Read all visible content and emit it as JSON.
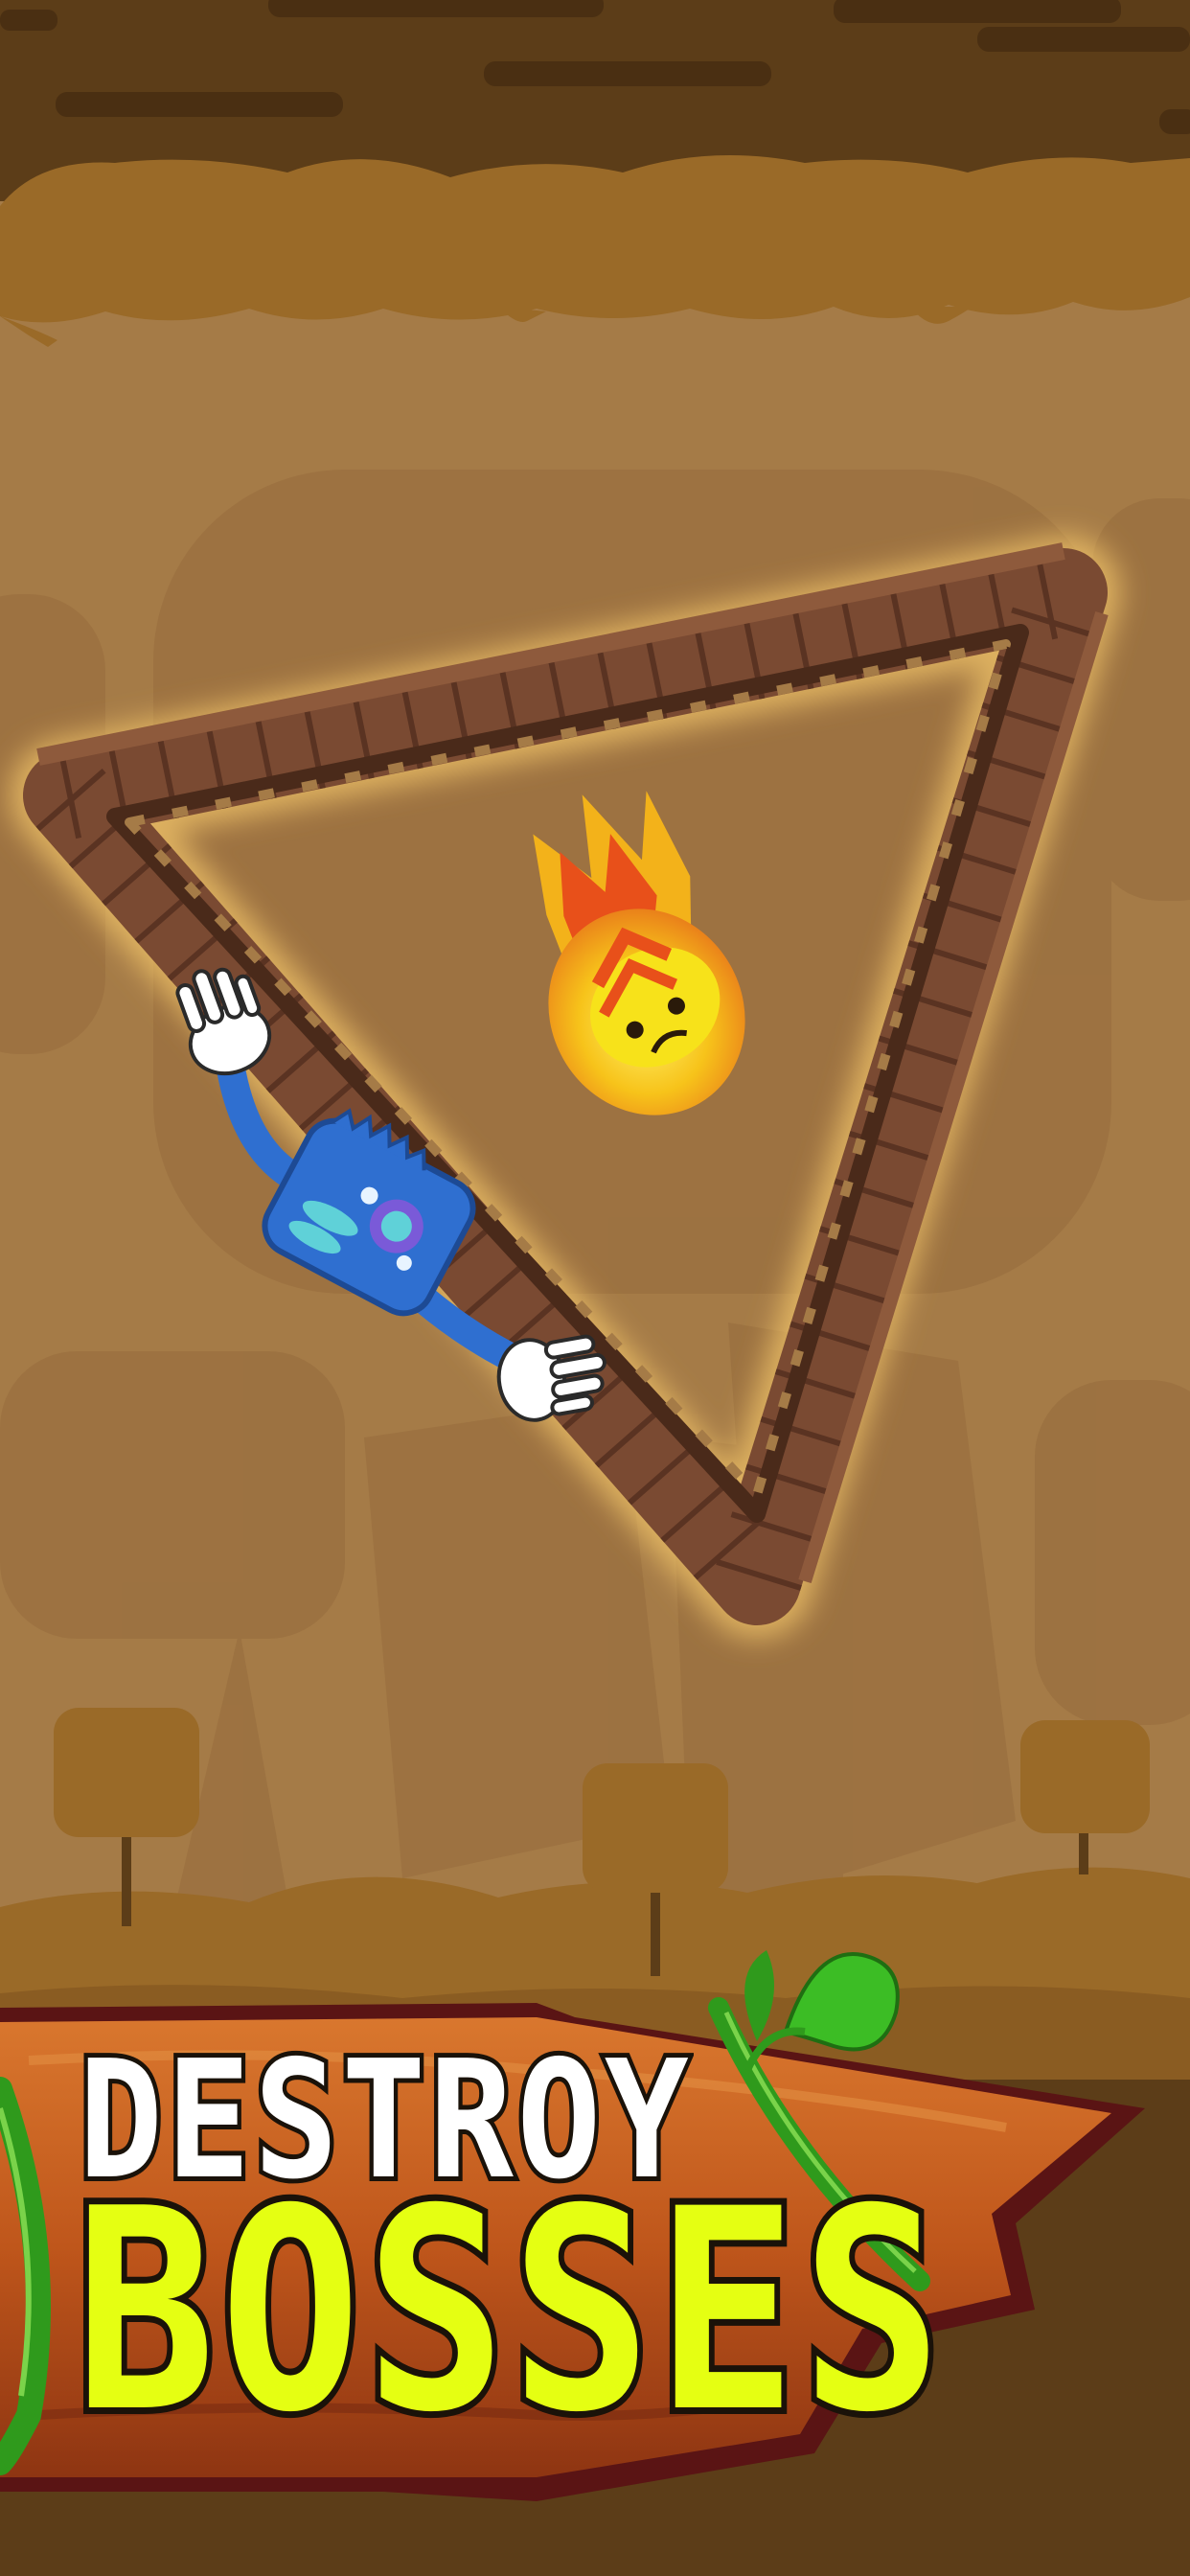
{
  "caption": {
    "line1": "DESTROY",
    "line2": "BOSSES"
  },
  "colors": {
    "cave_ceiling": "#5c3d18",
    "cave_band": "#9a6a28",
    "background": "#a57b47",
    "wall_brick": "#7a4a32",
    "wall_glow": "#f2c46a",
    "hero_blue": "#2f6fd0",
    "boss_yellow": "#f7e21a",
    "boss_fire": "#e8501a",
    "sign_wood": "#c45a1e",
    "title_white": "#ffffff",
    "title_yellow": "#e5ff12",
    "vine_green": "#2f9a1c"
  },
  "characters": {
    "hero": "blue-monster-climber",
    "boss": "flaming-yellow-boss"
  }
}
